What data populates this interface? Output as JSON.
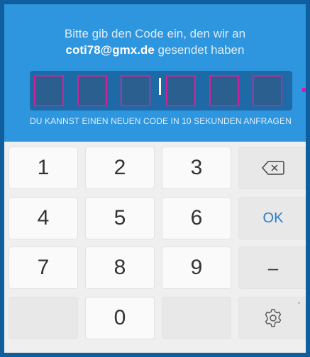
{
  "prompt": {
    "line1": "Bitte gib den Code ein, den wir an",
    "email": "coti78@gmx.de",
    "line2_suffix": " gesendet haben"
  },
  "code_input": {
    "digits": [
      "",
      "",
      "",
      "",
      "",
      ""
    ]
  },
  "resend_notice": "DU KANNST EINEN NEUEN CODE IN 10 SEKUNDEN ANFRAGEN",
  "keypad": {
    "keys": [
      "1",
      "2",
      "3",
      "4",
      "5",
      "6",
      "7",
      "8",
      "9",
      "0"
    ],
    "ok_label": "OK",
    "dash_label": "–",
    "backspace_icon": "backspace-icon",
    "settings_icon": "gear-icon"
  },
  "colors": {
    "accent": "#2e95df",
    "box_border": "#d3209a",
    "ok": "#2a7cc7"
  }
}
